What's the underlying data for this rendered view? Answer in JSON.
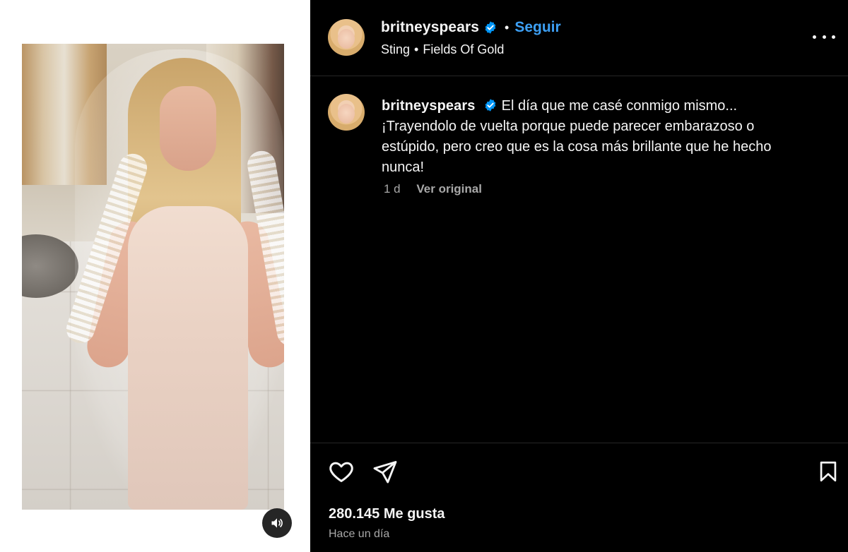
{
  "post": {
    "username": "britneyspears",
    "follow_label": "Seguir",
    "audio": {
      "artist": "Sting",
      "song": "Fields Of Gold"
    }
  },
  "caption": {
    "username": "britneyspears",
    "text": "El día que me casé conmigo mismo... ¡Trayendolo de vuelta porque puede parecer embarazoso o estúpido, pero creo que es la cosa más brillante que he hecho nunca!",
    "age": "1 d",
    "see_original_label": "Ver original"
  },
  "engagement": {
    "likes_label": "280.145 Me gusta",
    "posted_label": "Hace un día"
  },
  "icons": {
    "verified": "verified-badge-icon",
    "more": "more-options-icon",
    "like": "heart-icon",
    "share": "paper-plane-icon",
    "save": "bookmark-icon",
    "audio": "speaker-icon"
  },
  "colors": {
    "accent": "#3da0f5",
    "verified": "#0095f6",
    "background": "#000000",
    "muted": "#a8a8a8"
  }
}
